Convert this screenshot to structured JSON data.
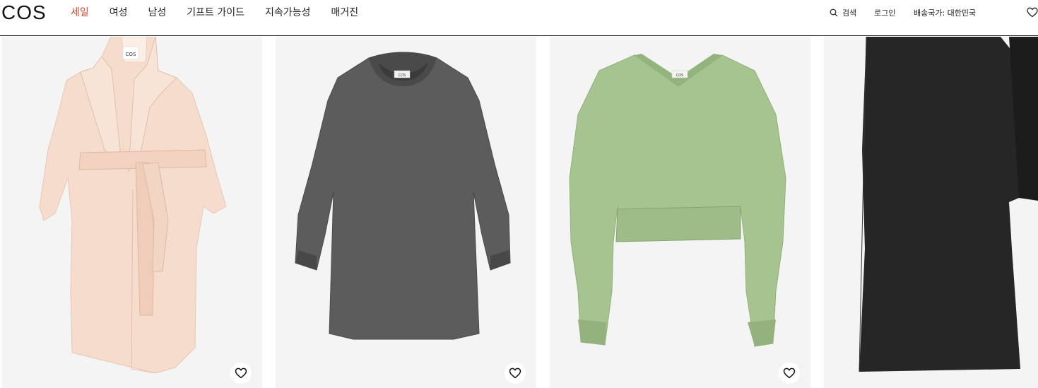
{
  "header": {
    "logo": "COS",
    "nav": [
      {
        "label": "세일",
        "highlight": true
      },
      {
        "label": "여성"
      },
      {
        "label": "남성"
      },
      {
        "label": "기프트 가이드"
      },
      {
        "label": "지속가능성"
      },
      {
        "label": "매거진"
      }
    ],
    "search_label": "검색",
    "login_label": "로그인",
    "shipping_label": "배송국가: 대한민국"
  },
  "products": [
    {
      "brand_tag": "COS",
      "color_name": "light pink coat"
    },
    {
      "brand_tag": "COS",
      "color_name": "grey sweatshirt dress"
    },
    {
      "brand_tag": "COS",
      "color_name": "green v-neck sweater"
    },
    {
      "color_name": "black dress"
    }
  ],
  "colors": {
    "sale": "#c5472c",
    "card_bg": "#f4f4f4",
    "coat": "#f5dccd",
    "grey": "#5c5c5c",
    "green": "#a6c48f",
    "black": "#262626"
  }
}
